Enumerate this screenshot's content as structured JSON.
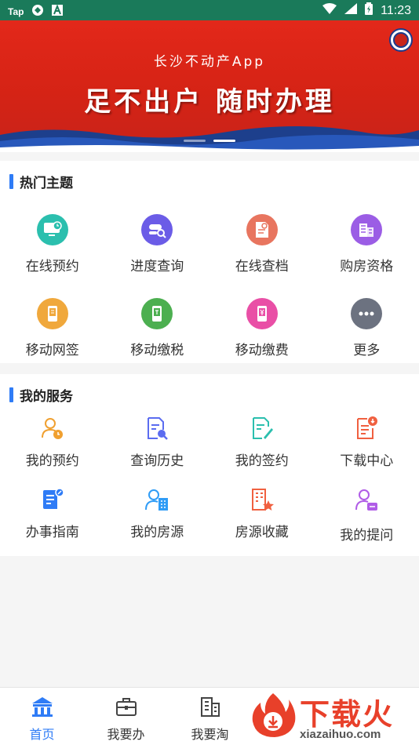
{
  "status_bar": {
    "left_text": "Tap",
    "time": "11:23"
  },
  "banner": {
    "subtitle": "长沙不动产App",
    "headline": "足不出户  随时办理"
  },
  "hot_topics": {
    "title": "热门主题",
    "items": [
      {
        "label": "在线预约",
        "icon": "monitor-clock-icon",
        "color": "#2bbfae"
      },
      {
        "label": "进度查询",
        "icon": "search-progress-icon",
        "color": "#6b5ce7"
      },
      {
        "label": "在线查档",
        "icon": "document-search-icon",
        "color": "#e8755f"
      },
      {
        "label": "购房资格",
        "icon": "building-check-icon",
        "color": "#9b5de5"
      },
      {
        "label": "移动网签",
        "icon": "mobile-sign-icon",
        "color": "#f0a83c"
      },
      {
        "label": "移动缴税",
        "icon": "mobile-tax-icon",
        "color": "#4caf50"
      },
      {
        "label": "移动缴费",
        "icon": "mobile-pay-icon",
        "color": "#e94fa6"
      },
      {
        "label": "更多",
        "icon": "more-icon",
        "color": "#6c7280"
      }
    ]
  },
  "my_services": {
    "title": "我的服务",
    "items": [
      {
        "label": "我的预约",
        "icon": "user-clock-icon",
        "color": "#f0a030"
      },
      {
        "label": "查询历史",
        "icon": "doc-history-icon",
        "color": "#5b6cf0"
      },
      {
        "label": "我的签约",
        "icon": "doc-edit-icon",
        "color": "#2bbfae"
      },
      {
        "label": "下载中心",
        "icon": "doc-download-icon",
        "color": "#f06040"
      },
      {
        "label": "办事指南",
        "icon": "guide-icon",
        "color": "#2f7cf6"
      },
      {
        "label": "我的房源",
        "icon": "user-building-icon",
        "color": "#2f9cf6"
      },
      {
        "label": "房源收藏",
        "icon": "building-star-icon",
        "color": "#f06040"
      },
      {
        "label": "我的提问",
        "icon": "user-question-icon",
        "color": "#b05ce7"
      }
    ]
  },
  "bottom_nav": {
    "items": [
      {
        "label": "首页",
        "icon": "home-icon",
        "active": true
      },
      {
        "label": "我要办",
        "icon": "briefcase-icon",
        "active": false
      },
      {
        "label": "我要淘",
        "icon": "building-icon",
        "active": false
      }
    ]
  },
  "watermark": {
    "title": "下载火",
    "url": "xiazaihuo.com"
  },
  "colors": {
    "accent": "#2f7cf6",
    "banner_red": "#d52315",
    "status_bar": "#1a7a5a"
  }
}
